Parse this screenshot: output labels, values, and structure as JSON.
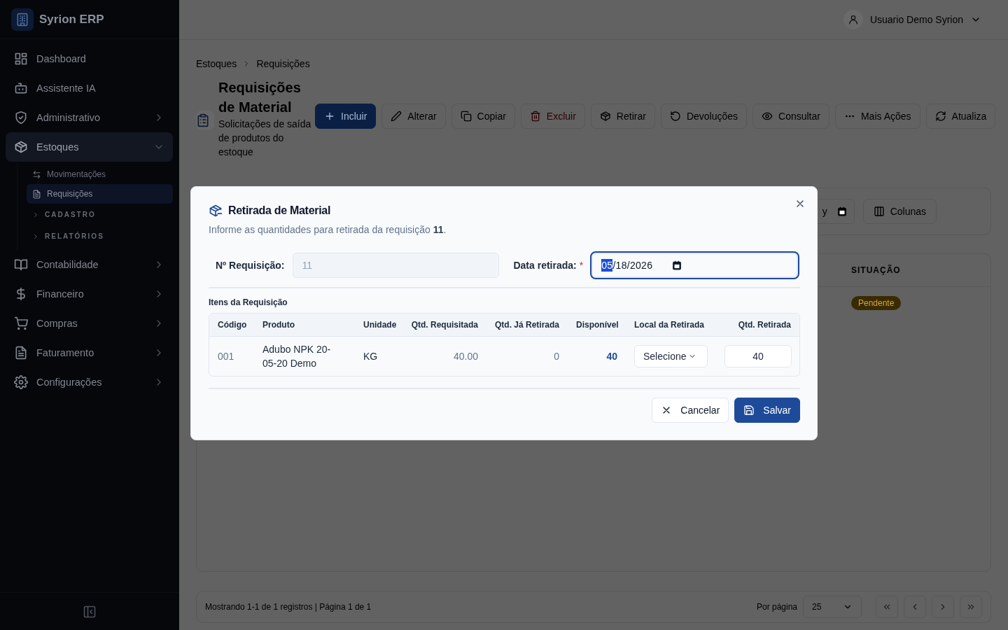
{
  "sidebar": {
    "brand": "Syrion ERP",
    "items": [
      {
        "label": "Dashboard",
        "kind": "link",
        "selected": false
      },
      {
        "label": "Assistente IA",
        "kind": "link",
        "selected": false
      },
      {
        "label": "Administrativo",
        "kind": "group",
        "selected": false,
        "expanded": false
      },
      {
        "label": "Estoques",
        "kind": "group",
        "selected": true,
        "expanded": true,
        "children": [
          {
            "label": "Movimentações",
            "kind": "link",
            "selected": false
          },
          {
            "label": "Requisições",
            "kind": "link",
            "selected": true
          },
          {
            "label": "CADASTRO",
            "kind": "section"
          },
          {
            "label": "RELATÓRIOS",
            "kind": "section"
          }
        ]
      },
      {
        "label": "Contabilidade",
        "kind": "group",
        "selected": false,
        "expanded": false
      },
      {
        "label": "Financeiro",
        "kind": "group",
        "selected": false,
        "expanded": false
      },
      {
        "label": "Compras",
        "kind": "group",
        "selected": false,
        "expanded": false
      },
      {
        "label": "Faturamento",
        "kind": "group",
        "selected": false,
        "expanded": false
      },
      {
        "label": "Configurações",
        "kind": "group",
        "selected": false,
        "expanded": false
      }
    ]
  },
  "header": {
    "user_name": "Usuario Demo Syrion"
  },
  "breadcrumb": [
    "Estoques",
    "Requisições"
  ],
  "page": {
    "title": "Requisições de Material",
    "subtitle": "Solicitações de saída de produtos do estoque"
  },
  "toolbar": [
    {
      "label": "Incluir",
      "kind": "primary"
    },
    {
      "label": "Alterar",
      "kind": "default"
    },
    {
      "label": "Copiar",
      "kind": "default"
    },
    {
      "label": "Excluir",
      "kind": "danger"
    },
    {
      "label": "Retirar",
      "kind": "default"
    },
    {
      "label": "Devoluções",
      "kind": "default"
    },
    {
      "label": "Consultar",
      "kind": "default"
    },
    {
      "label": "Mais Ações",
      "kind": "default"
    },
    {
      "label": "Atualiza",
      "kind": "default"
    }
  ],
  "filters": {
    "date_fragment": "y",
    "columns_button": "Colunas"
  },
  "table": {
    "visible_column": "SITUAÇÃO",
    "rows": [
      {
        "status": "Pendente"
      }
    ]
  },
  "pagination": {
    "summary": "Mostrando 1-1 de 1 registros | Página 1 de 1",
    "per_page_label": "Por página",
    "per_page": "25"
  },
  "modal": {
    "title": "Retirada de Material",
    "description": "Informe as quantidades para retirada da requisição **11**.",
    "requisition_field": {
      "label": "Nº Requisição:",
      "value": "11",
      "disabled": true
    },
    "date_field": {
      "label": "Data retirada:",
      "required_mark": "*",
      "value": "05/18/2026",
      "focused": true
    },
    "items_title": "Itens da Requisição",
    "columns": [
      "Código",
      "Produto",
      "Unidade",
      "Qtd. Requisitada",
      "Qtd. Já Retirada",
      "Disponível",
      "Local da Retirada",
      "Qtd. Retirada"
    ],
    "rows": [
      {
        "code": "001",
        "product": "Adubo NPK 20-05-20 Demo",
        "unit": "KG",
        "requested": "40.00",
        "withdrawn": "0",
        "available": "40",
        "location": "Selecione",
        "quantity": "40"
      }
    ],
    "buttons": [
      {
        "label": "Cancelar",
        "kind": "secondary"
      },
      {
        "label": "Salvar",
        "kind": "primary"
      }
    ]
  }
}
